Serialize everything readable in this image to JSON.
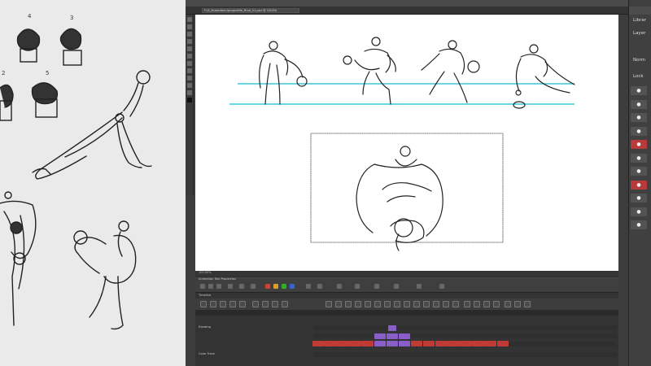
{
  "app": {
    "menu": [
      "",
      "",
      "",
      "",
      "",
      "",
      "",
      ""
    ],
    "document_tab": "F:/A_Illustration/projectfile_Final_01.psd @ 1000%",
    "status_text": "100.00%",
    "tool_properties_title": "Animation Tool Properties",
    "timeline_title": "Timeline",
    "layer_labels": [
      "Drawing",
      "",
      "",
      "Color Track"
    ]
  },
  "right_panel": {
    "tabs": [
      "Librar",
      "Layer",
      "Norm",
      "Lock"
    ],
    "eye_symbol": "●",
    "eye_colors": [
      "normal",
      "normal",
      "normal",
      "normal",
      "red",
      "normal",
      "normal",
      "red",
      "normal",
      "normal",
      "normal"
    ]
  },
  "colors": {
    "guide_cyan": "#3fc5d6",
    "keyframe_red": "#c03a36",
    "keyframe_purple": "#8a5ec9",
    "eye_red": "#b83a3a"
  },
  "paper": {
    "labels": [
      "4",
      "3",
      "2",
      "5"
    ]
  },
  "timeline": {
    "red_cells": 16,
    "purple_cells": 5
  }
}
